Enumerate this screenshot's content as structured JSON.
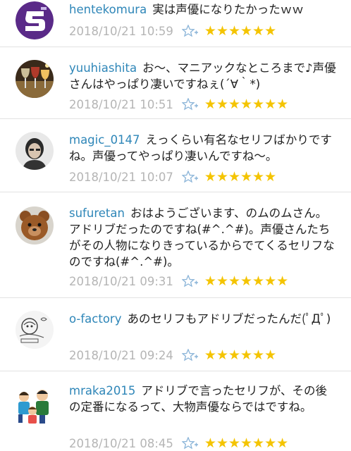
{
  "comments": [
    {
      "username": "hentekomura",
      "text": "実は声優になりたかったｗｗ",
      "timestamp": "2018/10/21 10:59",
      "stars": "★★★★★★",
      "avatar": "purple-logo-avatar"
    },
    {
      "username": "yuuhiashita",
      "text": "お～、マニアックなところまで♪声優さんはやっぱり凄いですねぇ(´∀｀*)",
      "timestamp": "2018/10/21 10:51",
      "stars": "★★★★★★★",
      "avatar": "wine-glasses-avatar"
    },
    {
      "username": "magic_0147",
      "text": "えっくらい有名なセリフばかりですね。声優ってやっぱり凄いんですね～。",
      "timestamp": "2018/10/21 10:07",
      "stars": "★★★★★★",
      "avatar": "portrait-avatar"
    },
    {
      "username": "sufuretan",
      "text": "おはようございます、のムのムさん。アドリブだったのですね(#^.^#)。声優さんたちがその人物になりきっているからでてくるセリフなのですね(#^.^#)。",
      "timestamp": "2018/10/21 09:31",
      "stars": "★★★★★★★",
      "avatar": "teddy-bear-avatar"
    },
    {
      "username": "o-factory",
      "text": "あのセリフもアドリブだったんだ(ﾟДﾟ)",
      "timestamp": "2018/10/21 09:24",
      "stars": "★★★★★★",
      "avatar": "sketch-logo-avatar"
    },
    {
      "username": "mraka2015",
      "text": "アドリブで言ったセリフが、その後の定番になるって、大物声優ならではですね。",
      "timestamp": "2018/10/21 08:45",
      "stars": "★★★★★★★",
      "avatar": "family-illustration-avatar"
    }
  ]
}
